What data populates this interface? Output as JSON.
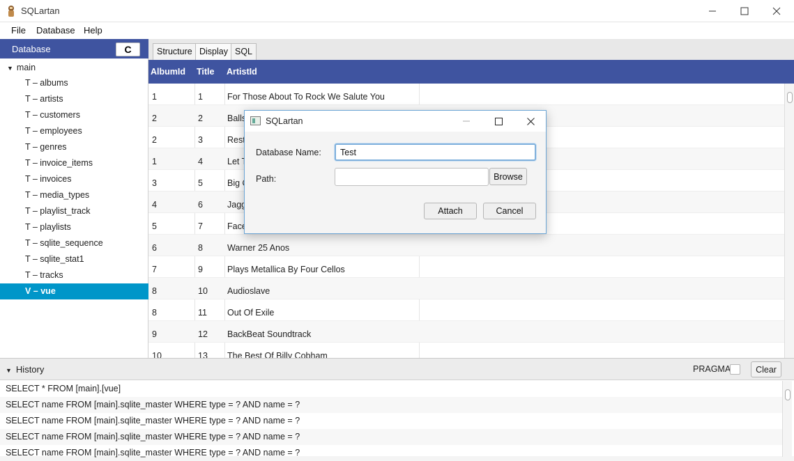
{
  "window": {
    "title": "SQLartan",
    "controls": {
      "minimize": "—",
      "maximize": "☐",
      "close": "✕"
    }
  },
  "menu": {
    "items": [
      "File",
      "Database",
      "Help"
    ]
  },
  "sidebar": {
    "header": "Database",
    "refresh_icon": "C",
    "root": "main",
    "items": [
      {
        "label": "T – albums",
        "selected": false
      },
      {
        "label": "T – artists",
        "selected": false
      },
      {
        "label": "T – customers",
        "selected": false
      },
      {
        "label": "T – employees",
        "selected": false
      },
      {
        "label": "T – genres",
        "selected": false
      },
      {
        "label": "T – invoice_items",
        "selected": false
      },
      {
        "label": "T – invoices",
        "selected": false
      },
      {
        "label": "T – media_types",
        "selected": false
      },
      {
        "label": "T – playlist_track",
        "selected": false
      },
      {
        "label": "T – playlists",
        "selected": false
      },
      {
        "label": "T – sqlite_sequence",
        "selected": false
      },
      {
        "label": "T – sqlite_stat1",
        "selected": false
      },
      {
        "label": "T – tracks",
        "selected": false
      },
      {
        "label": "V – vue",
        "selected": true
      }
    ]
  },
  "tabs": {
    "items": [
      "Structure",
      "Display",
      "SQL"
    ],
    "active": "Display"
  },
  "table": {
    "columns": [
      "AlbumId",
      "Title",
      "ArtistId"
    ],
    "rows": [
      [
        "1",
        "1",
        "For Those About To Rock We Salute You"
      ],
      [
        "2",
        "2",
        "Balls"
      ],
      [
        "2",
        "3",
        "Rest"
      ],
      [
        "1",
        "4",
        "Let T"
      ],
      [
        "3",
        "5",
        "Big O"
      ],
      [
        "4",
        "6",
        "Jagg"
      ],
      [
        "5",
        "7",
        "Face"
      ],
      [
        "6",
        "8",
        "Warner 25 Anos"
      ],
      [
        "7",
        "9",
        "Plays Metallica By Four Cellos"
      ],
      [
        "8",
        "10",
        "Audioslave"
      ],
      [
        "8",
        "11",
        "Out Of Exile"
      ],
      [
        "9",
        "12",
        "BackBeat Soundtrack"
      ],
      [
        "10",
        "13",
        "The Best Of Billy Cobham"
      ]
    ]
  },
  "history": {
    "title": "History",
    "pragma_label": "PRAGMA",
    "clear_label": "Clear",
    "rows": [
      "SELECT * FROM [main].[vue]",
      "SELECT name FROM [main].sqlite_master WHERE type = ? AND name = ?",
      "SELECT name FROM [main].sqlite_master WHERE type = ? AND name = ?",
      "SELECT name FROM [main].sqlite_master WHERE type = ? AND name = ?",
      "SELECT name FROM [main].sqlite_master WHERE type = ? AND name = ?"
    ]
  },
  "dialog": {
    "title": "SQLartan",
    "db_name_label": "Database Name:",
    "db_name_value": "Test",
    "path_label": "Path:",
    "path_value": "",
    "browse_label": "Browse",
    "attach_label": "Attach",
    "cancel_label": "Cancel"
  }
}
